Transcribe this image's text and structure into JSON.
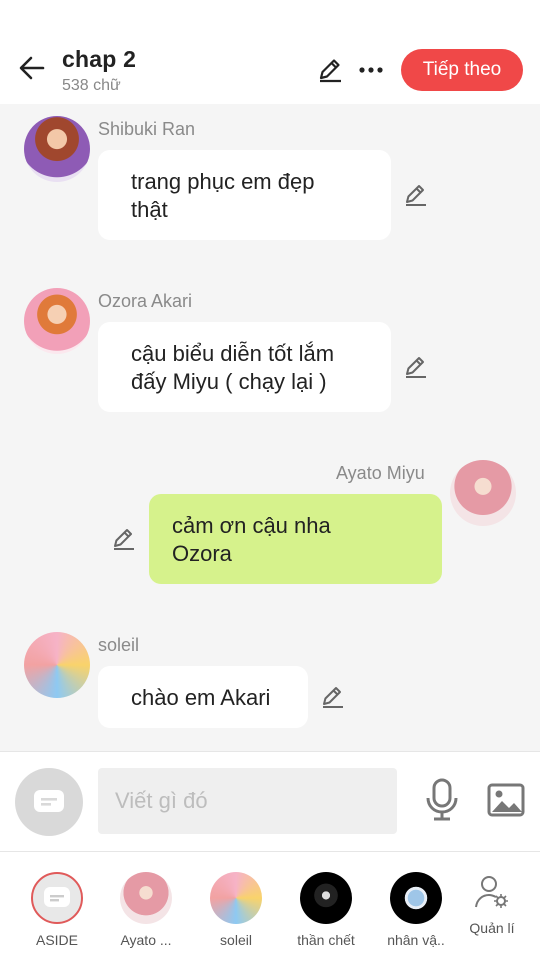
{
  "header": {
    "title": "chap  2",
    "subtitle": "538 chữ",
    "next_label": "Tiếp theo"
  },
  "messages": [
    {
      "sender": "Shibuki Ran",
      "text_lines": [
        "trang phục em đẹp",
        "thật"
      ],
      "side": "left"
    },
    {
      "sender": "Ozora Akari",
      "text_lines": [
        "cậu biểu diễn tốt lắm",
        "đấy Miyu ( chạy lại )"
      ],
      "side": "left"
    },
    {
      "sender": "Ayato  Miyu",
      "text_lines": [
        "cảm ơn cậu nha",
        "Ozora"
      ],
      "side": "right"
    },
    {
      "sender": "soleil",
      "text_lines": [
        "chào em Akari"
      ],
      "side": "left"
    }
  ],
  "composer": {
    "placeholder": "Viết gì đó"
  },
  "bottom_tabs": [
    {
      "label": "ASIDE",
      "active": true
    },
    {
      "label": "Ayato ..."
    },
    {
      "label": "soleil"
    },
    {
      "label": "thần chết"
    },
    {
      "label": "nhân vậ.."
    },
    {
      "label": "Quản lí"
    }
  ],
  "colors": {
    "accent": "#f04848",
    "my_bubble": "#d6f28c",
    "other_bubble": "#ffffff"
  },
  "icons": [
    "back-arrow-icon",
    "pencil-icon",
    "more-icon",
    "chat-icon",
    "mic-icon",
    "image-icon",
    "user-settings-icon"
  ]
}
